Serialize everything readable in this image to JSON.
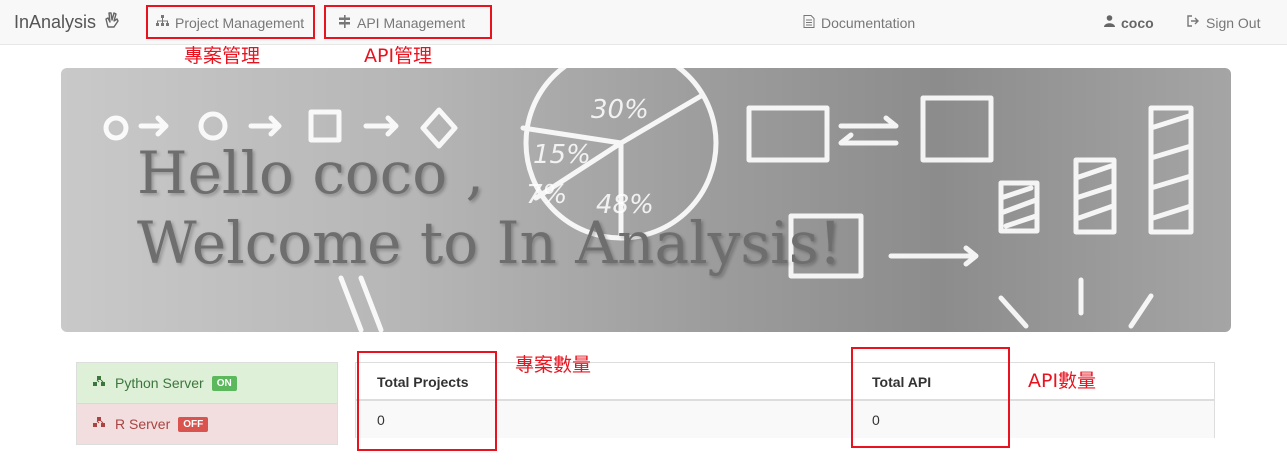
{
  "navbar": {
    "brand": "InAnalysis",
    "brand_icon": "hand-peace-icon",
    "items": [
      {
        "label": "Project Management",
        "icon": "sitemap-icon"
      },
      {
        "label": "API Management",
        "icon": "signpost-icon"
      },
      {
        "label": "Documentation",
        "icon": "file-text-icon"
      }
    ],
    "user": {
      "name": "coco",
      "icon": "user-icon"
    },
    "signout": {
      "label": "Sign Out",
      "icon": "sign-out-icon"
    }
  },
  "annotations": {
    "project_management": "專案管理",
    "api_management": "API管理",
    "project_count": "專案數量",
    "api_count": "API數量",
    "color": "#e8131f"
  },
  "hero": {
    "line1": "Hello coco ,",
    "line2": "Welcome to In Analysis!"
  },
  "servers": [
    {
      "name": "Python Server",
      "status": "ON",
      "icon": "cubes-icon",
      "color": "#5cb85c"
    },
    {
      "name": "R Server",
      "status": "OFF",
      "icon": "cubes-icon",
      "color": "#d9534f"
    }
  ],
  "stats": {
    "total_projects_label": "Total Projects",
    "total_projects_value": "0",
    "total_api_label": "Total API",
    "total_api_value": "0"
  }
}
